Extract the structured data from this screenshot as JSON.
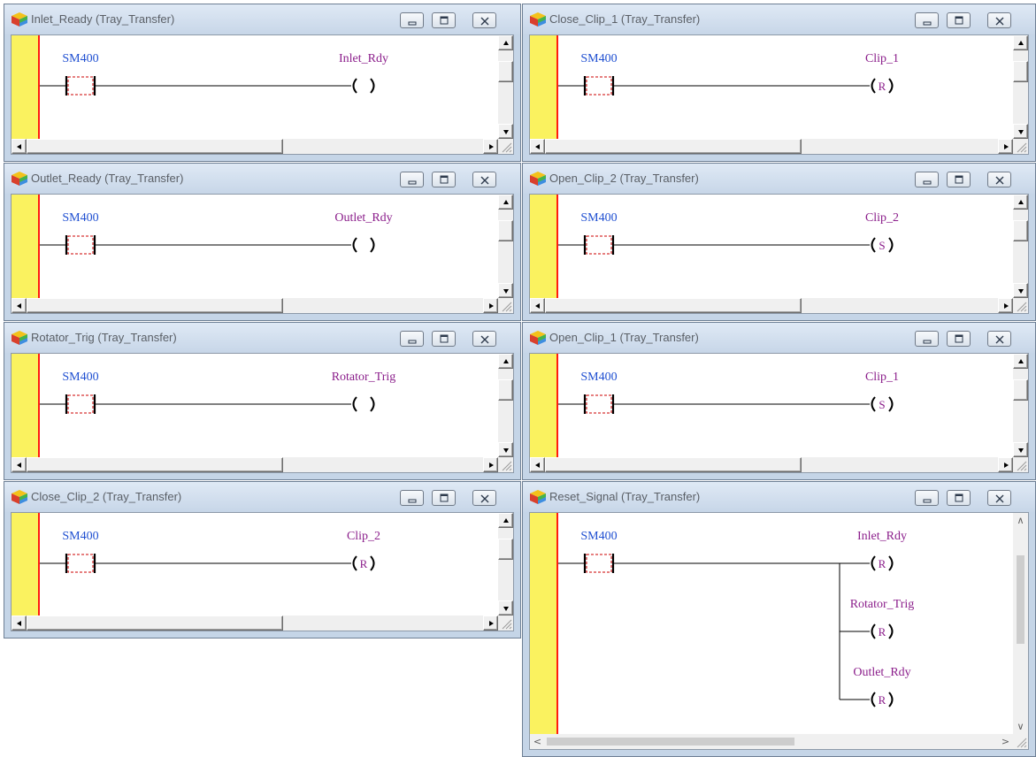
{
  "windows": [
    {
      "key": "inlet_ready",
      "title": "Inlet_Ready (Tray_Transfer)",
      "contact": "SM400",
      "coils": [
        {
          "name": "Inlet_Rdy",
          "letter": ""
        }
      ]
    },
    {
      "key": "close_clip_1",
      "title": "Close_Clip_1 (Tray_Transfer)",
      "contact": "SM400",
      "coils": [
        {
          "name": "Clip_1",
          "letter": "R"
        }
      ]
    },
    {
      "key": "outlet_ready",
      "title": "Outlet_Ready (Tray_Transfer)",
      "contact": "SM400",
      "coils": [
        {
          "name": "Outlet_Rdy",
          "letter": ""
        }
      ]
    },
    {
      "key": "open_clip_2",
      "title": "Open_Clip_2 (Tray_Transfer)",
      "contact": "SM400",
      "coils": [
        {
          "name": "Clip_2",
          "letter": "S"
        }
      ]
    },
    {
      "key": "rotator_trig",
      "title": "Rotator_Trig (Tray_Transfer)",
      "contact": "SM400",
      "coils": [
        {
          "name": "Rotator_Trig",
          "letter": ""
        }
      ]
    },
    {
      "key": "open_clip_1",
      "title": "Open_Clip_1 (Tray_Transfer)",
      "contact": "SM400",
      "coils": [
        {
          "name": "Clip_1",
          "letter": "S"
        }
      ]
    },
    {
      "key": "close_clip_2",
      "title": "Close_Clip_2 (Tray_Transfer)",
      "contact": "SM400",
      "coils": [
        {
          "name": "Clip_2",
          "letter": "R"
        }
      ]
    },
    {
      "key": "reset_signal",
      "title": "Reset_Signal (Tray_Transfer)",
      "contact": "SM400",
      "coils": [
        {
          "name": "Inlet_Rdy",
          "letter": "R"
        },
        {
          "name": "Rotator_Trig",
          "letter": "R"
        },
        {
          "name": "Outlet_Rdy",
          "letter": "R"
        }
      ]
    }
  ],
  "icons": {
    "app": "program-cube-icon",
    "minimize": "minimize-icon",
    "maximize": "maximize-icon",
    "close": "close-icon",
    "scroll_up": "scroll-up-arrow-icon",
    "scroll_down": "scroll-down-arrow-icon",
    "scroll_left": "scroll-left-arrow-icon",
    "scroll_right": "scroll-right-arrow-icon",
    "size_grip": "size-grip-icon"
  },
  "colors": {
    "rail": "#faf25f",
    "rail_line": "#ff1b10",
    "contact_label": "#1f4fd1",
    "coil_label": "#8b1e8b",
    "contact_dash": "#cc0000"
  }
}
